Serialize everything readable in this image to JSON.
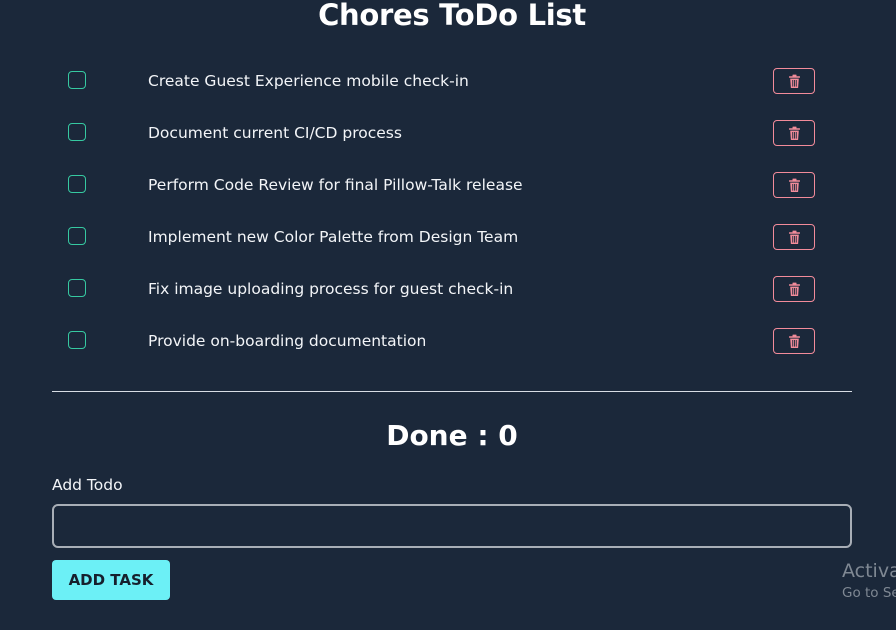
{
  "title": "Chores ToDo List",
  "todos": [
    {
      "text": "Create Guest Experience mobile check-in",
      "done": false
    },
    {
      "text": "Document current CI/CD process",
      "done": false
    },
    {
      "text": "Perform Code Review for final Pillow-Talk release",
      "done": false
    },
    {
      "text": "Implement new Color Palette from Design Team",
      "done": false
    },
    {
      "text": "Fix image uploading process for guest check-in",
      "done": false
    },
    {
      "text": "Provide on-boarding documentation",
      "done": false
    }
  ],
  "done_label": "Done : 0",
  "add_form": {
    "label": "Add Todo",
    "input_value": "",
    "button_label": "ADD TASK"
  },
  "watermark": {
    "line1": "Activa",
    "line2": "Go to Se"
  },
  "icons": {
    "checkbox": "checkbox-icon",
    "delete": "trash-icon"
  },
  "colors": {
    "background": "#1b283a",
    "checkbox_border": "#36c9a1",
    "delete_accent": "#f28b9a",
    "button_bg": "#6cf0f6"
  }
}
